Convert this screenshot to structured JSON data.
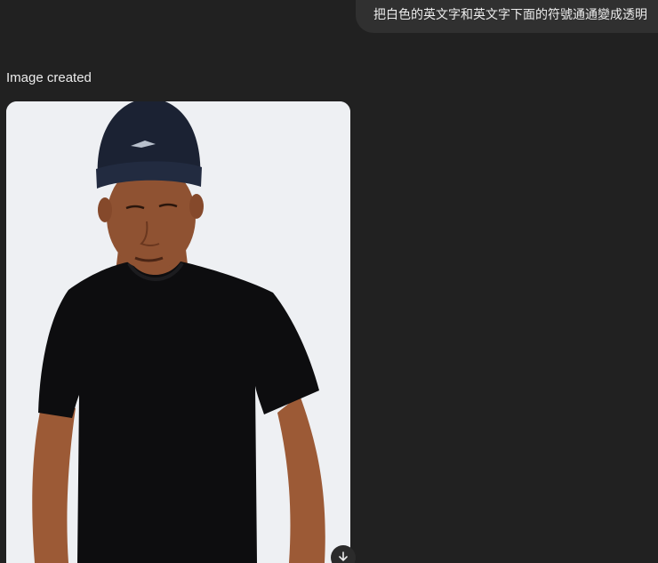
{
  "user_message": {
    "text": "把白色的英文字和英文字下面的符號通通變成透明"
  },
  "assistant": {
    "status_text": "Image created"
  },
  "generated_image": {
    "alt": "man in black beanie and black t-shirt"
  },
  "icons": {
    "download": "download-icon"
  },
  "colors": {
    "background": "#212121",
    "bubble": "#303030",
    "text": "#ececec"
  }
}
